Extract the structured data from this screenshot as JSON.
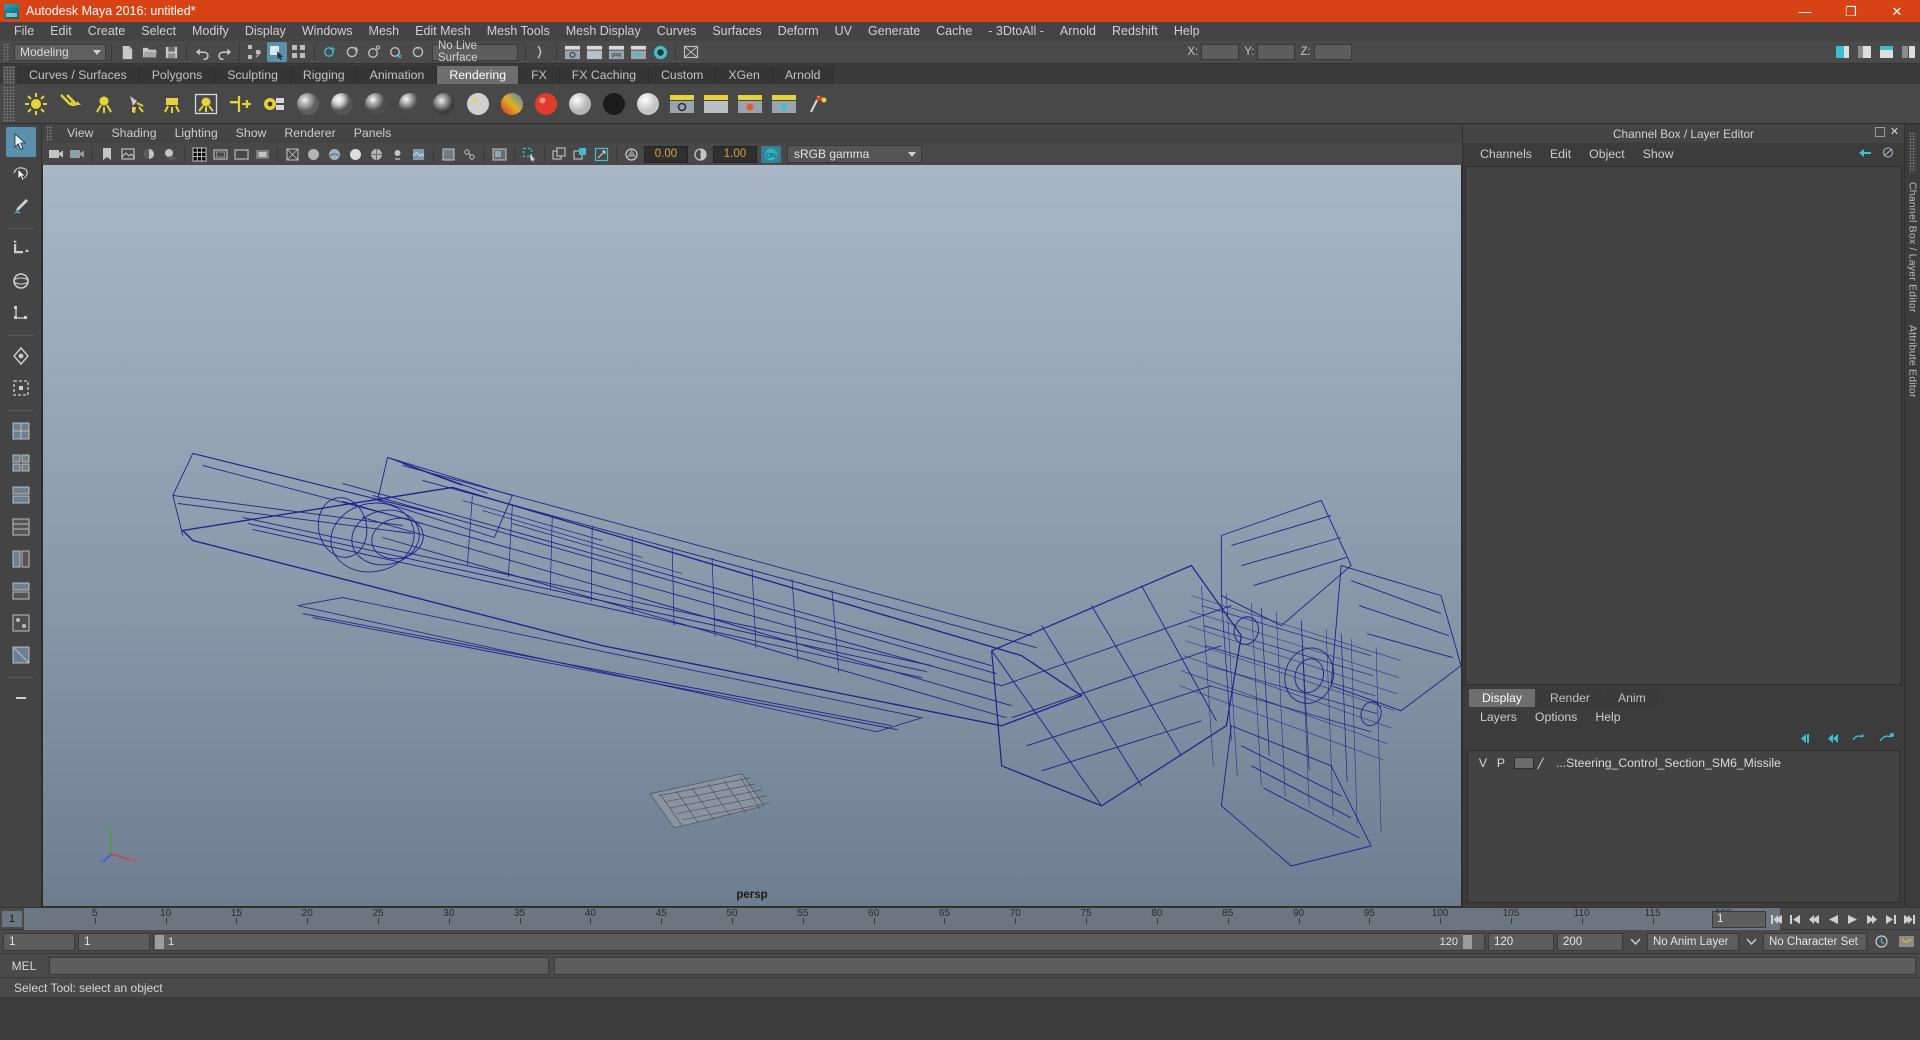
{
  "window": {
    "title": "Autodesk Maya 2016: untitled*",
    "logo_icon": "maya-logo-icon",
    "minimize_label": "—",
    "maximize_label": "❐",
    "close_label": "✕",
    "accent_color": "#d84315"
  },
  "menubar": {
    "items": [
      "File",
      "Edit",
      "Create",
      "Select",
      "Modify",
      "Display",
      "Windows",
      "Mesh",
      "Edit Mesh",
      "Mesh Tools",
      "Mesh Display",
      "Curves",
      "Surfaces",
      "Deform",
      "UV",
      "Generate",
      "Cache",
      "- 3DtoAll -",
      "Arnold",
      "Redshift",
      "Help"
    ]
  },
  "toolbar": {
    "menuset_value": "Modeling",
    "live_surface_value": "No Live Surface",
    "coord_labels": [
      "X:",
      "Y:",
      "Z:"
    ],
    "coord_values": [
      "",
      "",
      ""
    ],
    "icons": [
      "new-scene-icon",
      "open-scene-icon",
      "save-scene-icon",
      "undo-icon",
      "redo-icon",
      "select-by-hierarchy-icon",
      "select-by-object-icon",
      "select-by-component-icon",
      "snap-to-grid-icon",
      "snap-to-curve-icon",
      "snap-to-point-icon",
      "snap-to-projected-center-icon",
      "snap-to-view-plane-icon",
      "render-current-frame-icon",
      "ipr-render-icon",
      "render-settings-icon",
      "hypershade-icon",
      "render-view-icon",
      "editor-layout-single-icon",
      "editor-layout-split-icon",
      "editor-layout-four-icon",
      "outliner-icon"
    ]
  },
  "shelf_tabs": {
    "items": [
      "Curves / Surfaces",
      "Polygons",
      "Sculpting",
      "Rigging",
      "Animation",
      "Rendering",
      "FX",
      "FX Caching",
      "Custom",
      "XGen",
      "Arnold"
    ],
    "active": "Rendering"
  },
  "shelf": {
    "icons": [
      "ambient-light-icon",
      "directional-light-icon",
      "point-light-icon",
      "spot-light-icon",
      "area-light-icon",
      "volume-light-icon",
      "light-linking-icon",
      "light-centric-linking-icon",
      "lambert-material-icon",
      "blinn-material-icon",
      "phong-material-icon",
      "phonge-material-icon",
      "anisotropic-material-icon",
      "layered-shader-icon",
      "ramp-shader-icon",
      "surface-shader-icon",
      "use-background-icon",
      "gray-sphere-icon",
      "black-sphere-icon",
      "white-sphere-icon",
      "render-current-frame-icon",
      "ipr-render-icon",
      "render-settings-icon",
      "render-globals-icon",
      "render-flag-icon"
    ]
  },
  "tool_column": {
    "items": [
      "select-tool",
      "lasso-select-tool",
      "paint-select-tool",
      "move-tool",
      "rotate-tool",
      "scale-tool",
      "soft-modification-tool",
      "show-manipulator-tool",
      "last-tool-used",
      "quick-layout-single-pane",
      "quick-layout-two-pane-side",
      "quick-layout-two-pane-stacked",
      "quick-layout-four-pane",
      "quick-layout-persp-outliner",
      "quick-layout-persp-graph",
      "quick-layout-hypershade",
      "quick-layout-persp-uv",
      "quick-layout-more"
    ]
  },
  "viewport": {
    "menus": [
      "View",
      "Shading",
      "Lighting",
      "Show",
      "Renderer",
      "Panels"
    ],
    "camera_label": "persp",
    "toolbar": {
      "exposure_value": "0.00",
      "gamma_value": "1.00",
      "color_management_value": "sRGB gamma",
      "cm_toggle_label": "ON",
      "icons": [
        "select-camera-icon",
        "camera-attributes-icon",
        "bookmark-icon",
        "image-plane-icon",
        "two-sided-lighting-icon",
        "shadows-icon",
        "grid-icon",
        "film-gate-icon",
        "resolution-gate-icon",
        "gate-mask-icon",
        "xray-icon",
        "xray-joints-icon",
        "wireframe-icon",
        "smooth-shade-all-icon",
        "smooth-shade-textured-icon",
        "use-default-material-icon",
        "shaded-wireframe-icon",
        "lights-icon",
        "hardware-texturing-icon",
        "motion-blur-icon",
        "isolate-select-icon",
        "snapshot-icon",
        "exposure-icon",
        "gamma-icon"
      ]
    },
    "axis_gizmo": {
      "x": "x",
      "y": "y",
      "z": "z"
    },
    "object_wireframe_color": "#1a1a8c",
    "background_top": "#a9b6c6",
    "background_bottom": "#6e7d90"
  },
  "right_panel": {
    "header_title": "Channel Box / Layer Editor",
    "undock_icon": "undock-icon",
    "close_icon": "close-icon",
    "channelbox": {
      "menus": [
        "Channels",
        "Edit",
        "Object",
        "Show"
      ],
      "corner_icons": [
        "channel-box-toggle-icon",
        "attribute-editor-toggle-icon"
      ]
    },
    "layer_editor": {
      "tabs": [
        "Display",
        "Render",
        "Anim"
      ],
      "active_tab": "Display",
      "menus": [
        "Layers",
        "Options",
        "Help"
      ],
      "buttons": [
        "layer-first-icon",
        "layer-prev-icon",
        "layer-new-icon",
        "layer-new-from-selected-icon"
      ],
      "columns": [
        "V",
        "P"
      ],
      "layers": [
        {
          "visible": "V",
          "playback": "P",
          "color_swatch": "#6b6b6b",
          "name": "...Steering_Control_Section_SM6_Missile"
        }
      ]
    },
    "side_tabs": [
      "Channel Box / Layer Editor",
      "Attribute Editor"
    ]
  },
  "timeline": {
    "start_frame_label": "1",
    "ticks": [
      5,
      10,
      15,
      20,
      25,
      30,
      35,
      40,
      45,
      50,
      55,
      60,
      65,
      70,
      75,
      80,
      85,
      90,
      95,
      100,
      105,
      110,
      115,
      120
    ],
    "current_frame": "1",
    "playback_buttons": [
      "go-to-start-icon",
      "step-back-frame-icon",
      "step-back-key-icon",
      "play-backwards-icon",
      "play-forwards-icon",
      "step-forward-key-icon",
      "step-forward-frame-icon",
      "go-to-end-icon"
    ]
  },
  "range_row": {
    "anim_start": "1",
    "range_start": "1",
    "range_bar_left": "1",
    "range_bar_right": "120",
    "range_end": "120",
    "anim_end": "200",
    "anim_layer": "No Anim Layer",
    "character_set": "No Character Set",
    "auto_key_icon": "auto-keyframe-icon",
    "anim_prefs_icon": "animation-preferences-icon"
  },
  "command_line": {
    "label": "MEL",
    "input_value": "",
    "output_value": ""
  },
  "status_bar": {
    "message": "Select Tool: select an object"
  }
}
